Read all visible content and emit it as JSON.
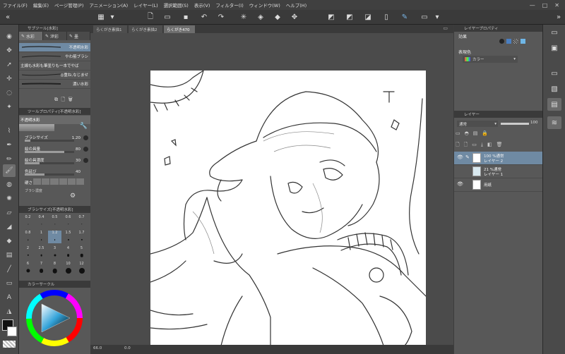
{
  "menu": [
    "ファイル(F)",
    "編集(E)",
    "ページ管理(P)",
    "アニメーション(A)",
    "レイヤー(L)",
    "選択範囲(S)",
    "表示(V)",
    "フィルター(I)",
    "ウィンドウ(W)",
    "ヘルプ(H)"
  ],
  "window_controls": {
    "minimize": "—",
    "maximize": "□",
    "close": "✕"
  },
  "canvas_tabs": [
    "らくがき素描1",
    "らくがき素描2",
    "らくがき470"
  ],
  "subtool_panel": {
    "header": "サブツール[水彩]",
    "tabs": [
      "水彩",
      "滲彩",
      "墨"
    ],
    "brushes": [
      "不透明水彩",
      "やわ筋ブラシ",
      "主線も水彩も筆塗りも一本でやば",
      "◎重ね,なじませ",
      "濃い水彩"
    ]
  },
  "tool_property": {
    "header": "ツールプロパティ[不透明水彩]",
    "brush_name": "不透明水彩",
    "props": [
      {
        "name": "ブラシサイズ",
        "value": "1.20",
        "fill": 0.12
      },
      {
        "name": "絵の具量",
        "value": "80",
        "fill": 0.8
      },
      {
        "name": "絵の具濃度",
        "value": "30",
        "fill": 0.3
      },
      {
        "name": "色延び",
        "value": "40",
        "fill": 0.4
      }
    ],
    "blur_label": "硬さ",
    "extra_label": "ブラシ濃度"
  },
  "brush_size_panel": {
    "header": "ブラシサイズ[不透明水彩]",
    "sizes": [
      "0.2",
      "0.4",
      "0.5",
      "0.6",
      "0.7",
      "0.8",
      "1",
      "1.2",
      "1.5",
      "1.7",
      "2",
      "2.5",
      "3",
      "4",
      "5",
      "6",
      "7",
      "8",
      "10",
      "12"
    ],
    "selected": "1.2"
  },
  "color_panel": {
    "header": "カラーサークル"
  },
  "status": {
    "zoom": "66.0",
    "rotation": "0.0"
  },
  "layer_property": {
    "header": "レイヤープロパティ",
    "effect_label": "効果",
    "expression_label": "表現色",
    "expression_value": "カラー"
  },
  "layer_panel": {
    "header": "レイヤー",
    "blend_mode": "通常",
    "opacity": "100",
    "layers": [
      {
        "line1": "100 %通常",
        "line2": "レイヤー 2",
        "selected": true
      },
      {
        "line1": "21 %通常",
        "line2": "レイヤー 1",
        "selected": false
      },
      {
        "line1": "用紙",
        "line2": "",
        "selected": false
      }
    ]
  }
}
